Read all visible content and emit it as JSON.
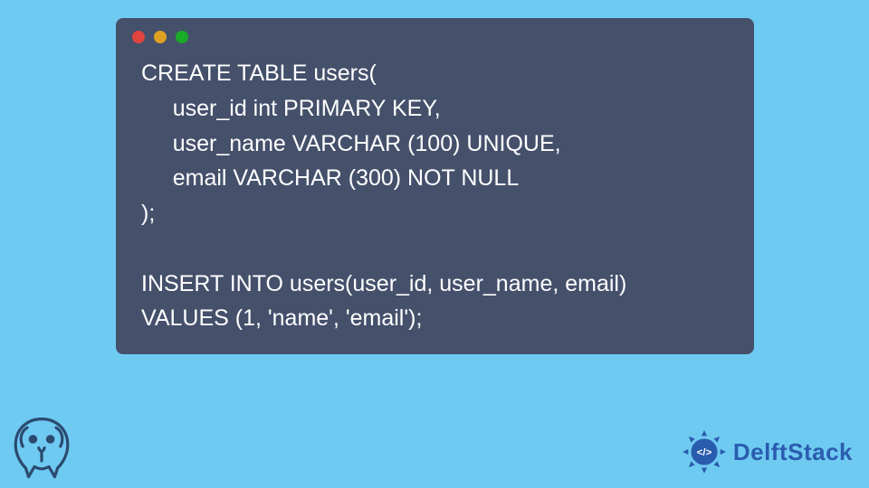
{
  "code": {
    "lines": [
      "CREATE TABLE users(",
      "     user_id int PRIMARY KEY,",
      "     user_name VARCHAR (100) UNIQUE,",
      "     email VARCHAR (300) NOT NULL",
      ");",
      "",
      "INSERT INTO users(user_id, user_name, email)",
      "VALUES (1, 'name', 'email');"
    ]
  },
  "window_dots": {
    "red": "#e0443e",
    "yellow": "#dea123",
    "green": "#1aab29"
  },
  "brand": {
    "text": "DelftStack"
  },
  "icons": {
    "postgres": "postgresql-elephant-icon",
    "gear": "delftstack-gear-icon"
  }
}
